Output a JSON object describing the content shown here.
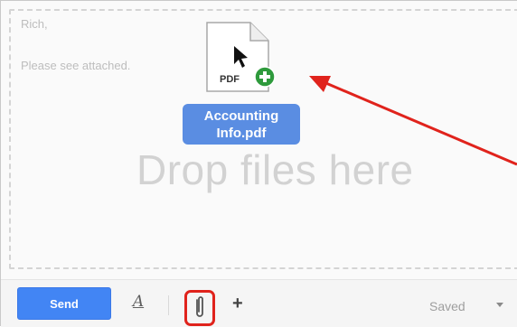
{
  "email": {
    "greeting": "Rich,",
    "message": "Please see attached."
  },
  "drop_zone": {
    "text": "Drop files here"
  },
  "dragged_file": {
    "name_line1": "Accounting",
    "name_line2": "Info.pdf",
    "icon_text": "PDF",
    "icon": "pdf-file-icon"
  },
  "toolbar": {
    "send_label": "Send",
    "format_label": "A",
    "more_label": "+",
    "status": "Saved"
  },
  "colors": {
    "send_button": "#4285f4",
    "file_label": "#4d84e0",
    "annotation_red": "#e0231c",
    "badge_green": "#2e9a3c"
  }
}
